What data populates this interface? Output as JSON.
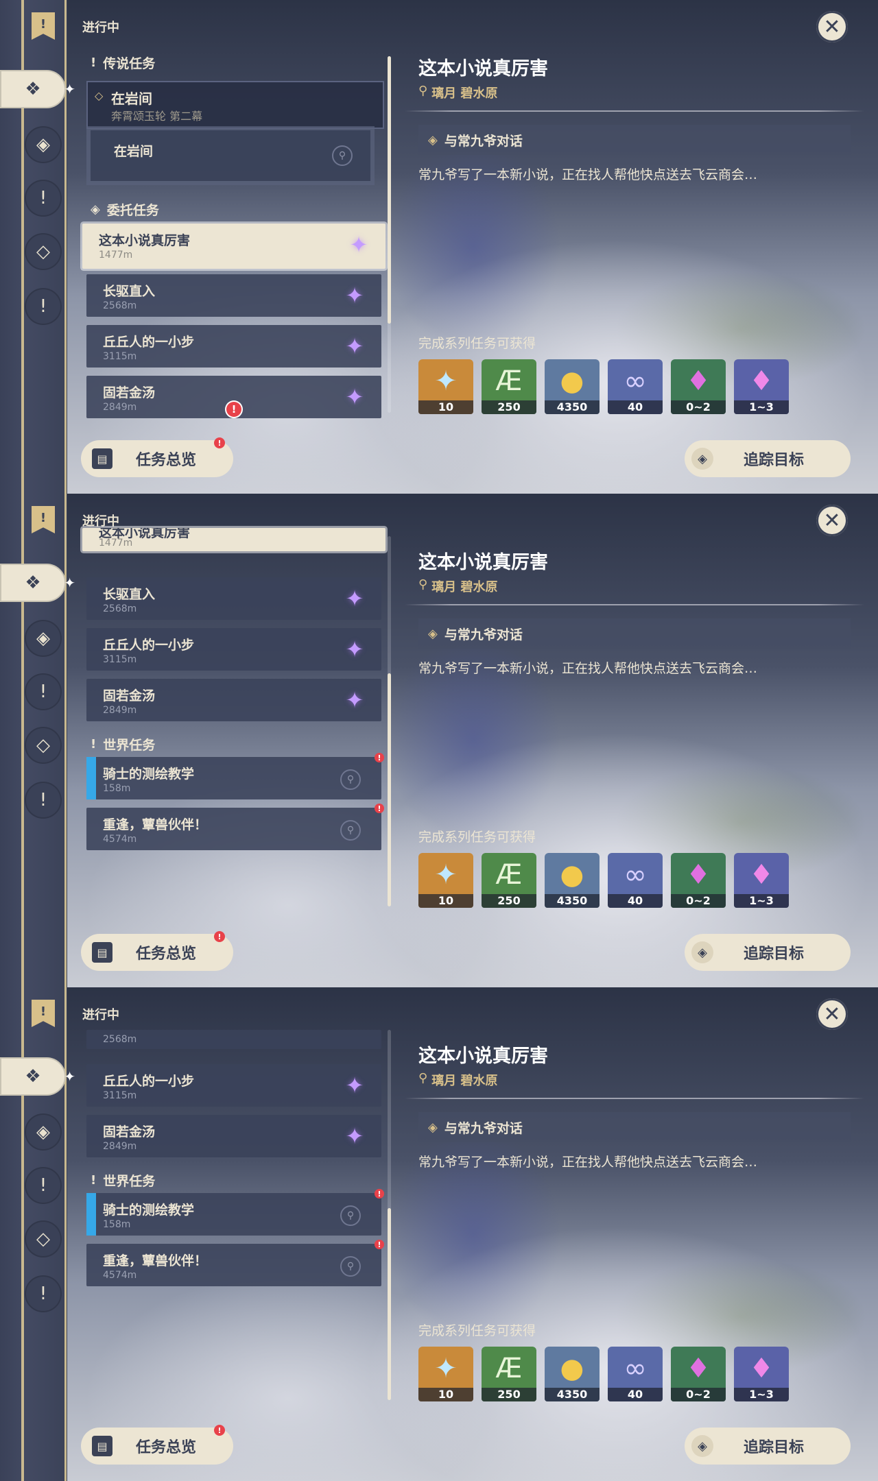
{
  "header": {
    "section_label": "进行中"
  },
  "left_rail": {
    "flag_glyph": "!",
    "buttons": [
      {
        "icon": "all-quests-icon",
        "glyph": "❖",
        "active": true
      },
      {
        "icon": "archon-quest-icon",
        "glyph": "◈",
        "active": false
      },
      {
        "icon": "story-quest-icon",
        "glyph": "!",
        "active": false
      },
      {
        "icon": "commission-icon",
        "glyph": "◇",
        "active": false
      },
      {
        "icon": "world-quest-icon",
        "glyph": "!",
        "active": false
      }
    ]
  },
  "list": {
    "legend_category": "传说任务",
    "legend_quest": {
      "name": "在岩间",
      "sub": "奔霄颂玉轮 第二幕",
      "subquest": "在岩间"
    },
    "commission_category": "委托任务",
    "world_category": "世界任务",
    "commissions": [
      {
        "name": "这本小说真厉害",
        "distance": "1477m"
      },
      {
        "name": "长驱直入",
        "distance": "2568m"
      },
      {
        "name": "丘丘人的一小步",
        "distance": "3115m"
      },
      {
        "name": "固若金汤",
        "distance": "2849m"
      }
    ],
    "world_quests": [
      {
        "name": "骑士的测绘教学",
        "distance": "158m"
      },
      {
        "name": "重逢，蕈兽伙伴！",
        "distance": "4574m"
      }
    ]
  },
  "buttons": {
    "overview": "任务总览",
    "track": "追踪目标",
    "alert": "!"
  },
  "detail": {
    "title": "这本小说真厉害",
    "location": "璃月 碧水原",
    "objective": "与常九爷对话",
    "description": "常九爷写了一本新小说，正在找人帮他快点送去飞云商会…",
    "rewards_heading": "完成系列任务可获得",
    "rewards": [
      {
        "item": "primogem",
        "count": "10",
        "color": "#c98a3a"
      },
      {
        "item": "adventure-exp",
        "count": "250",
        "color": "#4f8a4a"
      },
      {
        "item": "mora",
        "count": "4350",
        "color": "#5f7aa0"
      },
      {
        "item": "companionship-exp",
        "count": "40",
        "color": "#5a6aa8"
      },
      {
        "item": "crystal-chunk-large",
        "count": "0~2",
        "color": "#3f7a56"
      },
      {
        "item": "crystal-chunk-small",
        "count": "1~3",
        "color": "#5a62a8"
      }
    ]
  },
  "colors": {
    "cream": "#ece5d3",
    "navy": "#3b4256",
    "gold": "#d8c08a",
    "alert": "#e8424a"
  }
}
